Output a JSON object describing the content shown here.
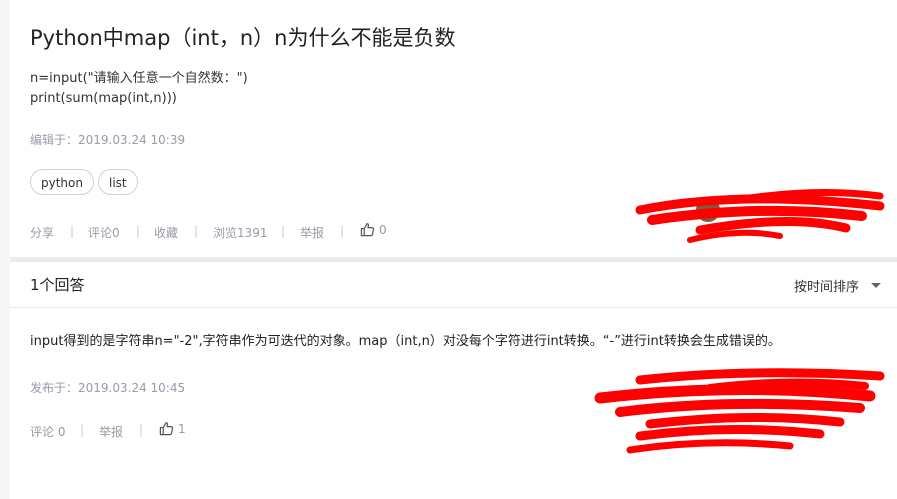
{
  "question": {
    "title": "Python中map（int，n）n为什么不能是负数",
    "code_lines": [
      "n=input(\"请输入任意一个自然数：\")",
      "print(sum(map(int,n)))"
    ],
    "edited_at": "编辑于：2019.03.24 10:39",
    "tags": [
      "python",
      "list"
    ],
    "actions": {
      "share": "分享",
      "comment": "评论0",
      "collect": "收藏",
      "views": "浏览1391",
      "report": "举报",
      "likes": "0"
    }
  },
  "answers_section": {
    "count_title": "1个回答",
    "sort_label": "按时间排序"
  },
  "answer": {
    "text": "input得到的是字符串n=\"-2\",字符串作为可迭代的对象。map（int,n）对没每个字符进行int转换。“-”进行int转换会生成错误的。",
    "published_at": "发布于：2019.03.24 10:45",
    "actions": {
      "comment": "评论 0",
      "report": "举报",
      "likes": "1"
    }
  },
  "colors": {
    "redaction": "#ff0000",
    "background": "#f5f6f7",
    "meta_text": "#999aaa"
  },
  "icons": [
    "thumbs-up-icon",
    "chevron-down-icon",
    "avatar"
  ]
}
